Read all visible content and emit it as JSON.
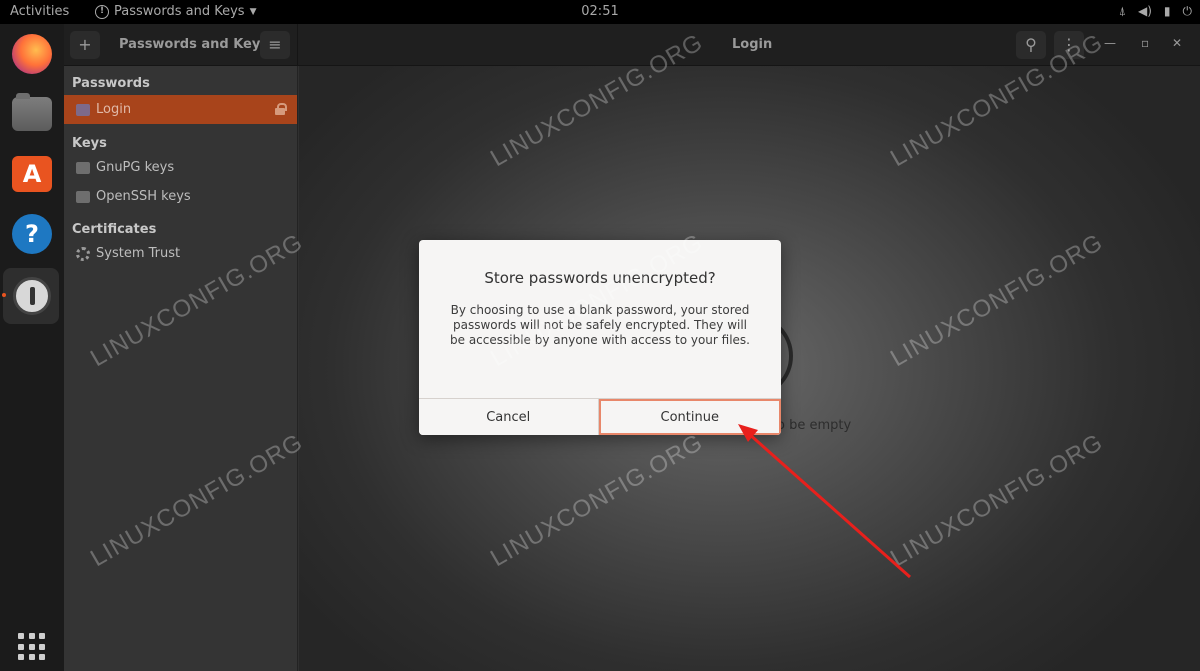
{
  "topbar": {
    "activities": "Activities",
    "app_menu": "Passwords and Keys",
    "clock": "02:51",
    "tray_icons": [
      "network-icon",
      "volume-icon",
      "battery-icon",
      "power-icon"
    ]
  },
  "dock": {
    "apps": [
      "Firefox",
      "Files",
      "Ubuntu Software",
      "Help",
      "Passwords and Keys"
    ],
    "active_app": "Passwords and Keys"
  },
  "window": {
    "title_left": "Passwords and Keys",
    "title_center": "Login"
  },
  "sidebar": {
    "sections": [
      {
        "heading": "Passwords",
        "items": [
          {
            "label": "Login",
            "selected": true,
            "locked": true
          }
        ]
      },
      {
        "heading": "Keys",
        "items": [
          {
            "label": "GnuPG keys"
          },
          {
            "label": "OpenSSH keys"
          }
        ]
      },
      {
        "heading": "Certificates",
        "items": [
          {
            "label": "System Trust"
          }
        ]
      }
    ]
  },
  "content": {
    "empty_text": "o be empty"
  },
  "dialog": {
    "title": "Store passwords unencrypted?",
    "body": "By choosing to use a blank password, your stored passwords will not be safely encrypted. They will be accessible by anyone with access to your files.",
    "cancel_label": "Cancel",
    "continue_label": "Continue"
  },
  "watermark": "LINUXCONFIG.ORG",
  "colors": {
    "accent": "#e95420",
    "selected_row": "#a8441b",
    "annotation_arrow": "#e8201c"
  }
}
